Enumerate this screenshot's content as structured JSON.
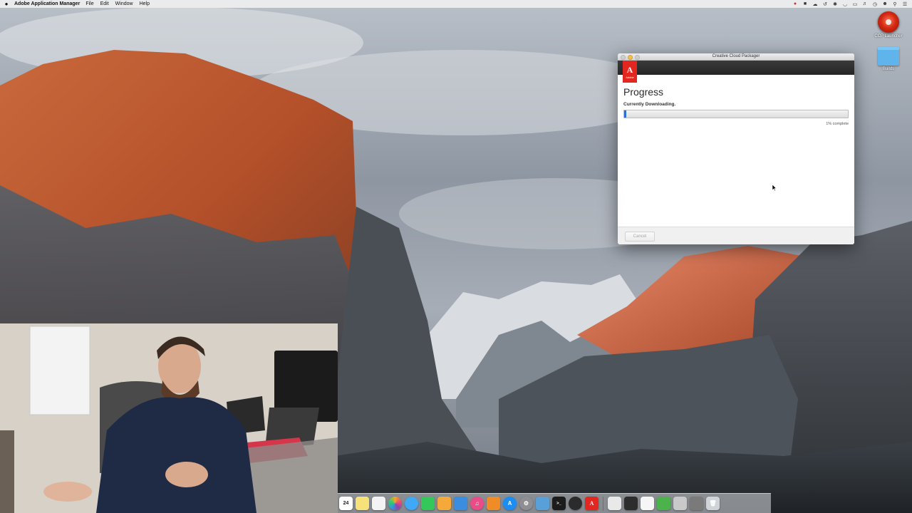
{
  "menubar": {
    "apple_symbol": "",
    "app_name": "Adobe Application Manager",
    "menus": [
      "File",
      "Edit",
      "Window",
      "Help"
    ]
  },
  "desktop": {
    "icons": [
      {
        "label": "CCP Launcher",
        "icon": "ccp-launcher-icon"
      },
      {
        "label": "Builds",
        "icon": "folder-icon"
      }
    ]
  },
  "window": {
    "title": "Creative Cloud Packager",
    "logo_text": "A",
    "logo_subtext": "Adobe",
    "heading": "Progress",
    "status": "Currently Downloading.",
    "progress_percent": 1,
    "progress_label": "1% complete",
    "cancel_label": "Cancel",
    "cancel_enabled": false
  },
  "dock": {
    "calendar_day": "24",
    "apps": [
      "calendar",
      "notes",
      "reminders",
      "photos",
      "messages",
      "facetime",
      "pages",
      "keynote",
      "itunes",
      "ibooks",
      "app-store",
      "system-preferences",
      "preview",
      "terminal",
      "obs",
      "adobe-application-manager",
      "documents",
      "screen-recording",
      "textedit",
      "finder-doc",
      "downloads",
      "trash"
    ]
  },
  "colors": {
    "adobe_red": "#e3261f",
    "progress_blue": "#2f6fd0",
    "window_header": "#2c2c2c"
  }
}
